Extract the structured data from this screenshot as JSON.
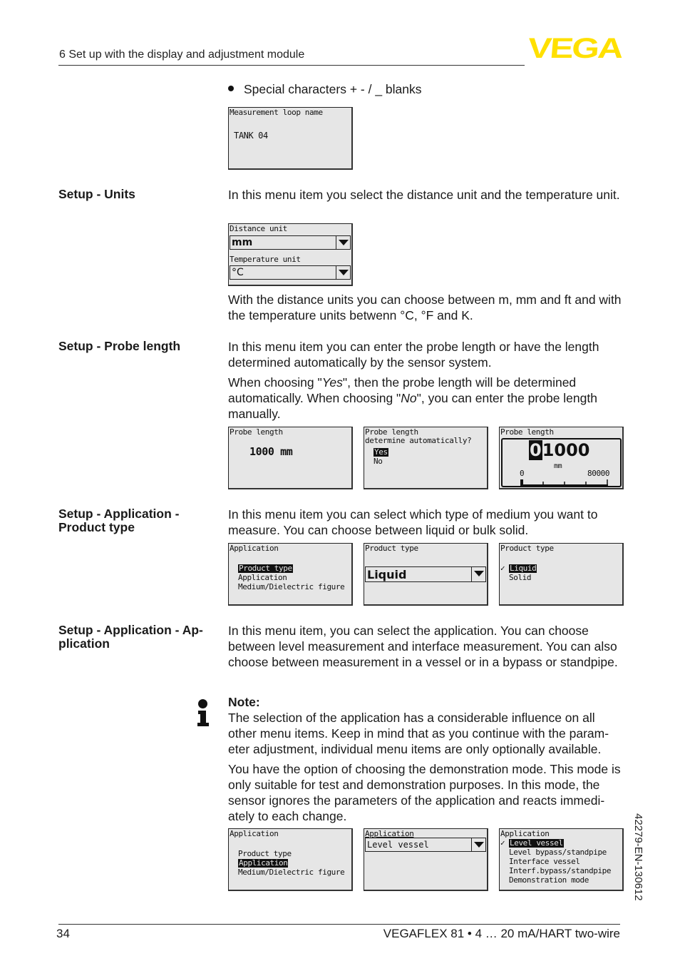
{
  "header": {
    "title": "6 Set up with the display and adjustment module",
    "logo_text": "VEGA",
    "logo_color": "#ffe000"
  },
  "intro": {
    "bullet": "Special characters + - / _ blanks"
  },
  "lcd_loop_name": {
    "title": "Measurement loop name",
    "value": "TANK 04"
  },
  "units": {
    "label": "Setup - Units",
    "text1": "In this menu item you select the distance unit and the temperature unit.",
    "lcd": {
      "distance_label": "Distance unit",
      "distance_value": "mm",
      "temperature_label": "Temperature unit",
      "temperature_value": "°C"
    },
    "text2": "With the distance units you can choose between m, mm and ft and with the temperature units betwenn °C, °F and K."
  },
  "probe_length": {
    "label": "Setup - Probe length",
    "text1": "In this menu item you can enter the probe length or have the length determined automatically by the sensor system.",
    "text2_pre": "When choosing \"",
    "text2_yes": "Yes",
    "text2_mid": "\", then the probe length will be determined automatically. When choosing \"",
    "text2_no": "No",
    "text2_post": "\", you can enter the probe length manually.",
    "lcd1": {
      "title": "Probe length",
      "value": "1000 mm"
    },
    "lcd2": {
      "title": "Probe length",
      "subtitle": "determine automatically?",
      "options": [
        "Yes",
        "No"
      ],
      "selected": "Yes"
    },
    "lcd3": {
      "title": "Probe length",
      "cursor_digit": "0",
      "value_rest": "1000",
      "unit": "mm",
      "scale_min": "0",
      "scale_max": "80000"
    }
  },
  "product_type": {
    "label_line1": "Setup - Application -",
    "label_line2": "Product type",
    "text": "In this menu item you can select which type of medium you want to measure. You can choose between liquid or bulk solid.",
    "lcd1": {
      "title": "Application",
      "items": [
        "Product type",
        "Application",
        "Medium/Dielectric figure"
      ],
      "selected": "Product type"
    },
    "lcd2": {
      "title": "Product type",
      "value": "Liquid"
    },
    "lcd3": {
      "title": "Product type",
      "options": [
        "Liquid",
        "Solid"
      ],
      "selected": "Liquid",
      "check": "✓"
    }
  },
  "application": {
    "label_line1": "Setup - Application - Ap-",
    "label_line2": "plication",
    "text": "In this menu item, you can select the application. You can choose between level measurement and interface measurement. You can also choose between measurement in a vessel or in a bypass or standpipe.",
    "note_title": "Note:",
    "note_text": "The selection of the application has a considerable influence on all other menu items. Keep in mind that as you continue with the param-eter adjustment, individual menu items are only optionally available.",
    "demo_text": "You have the option of choosing the demonstration mode. This mode is only suitable for test and demonstration purposes. In this mode, the sensor ignores the parameters of the application and reacts immedi-ately to each change.",
    "lcd1": {
      "title": "Application",
      "items": [
        "Product type",
        "Application",
        "Medium/Dielectric figure"
      ],
      "selected": "Application"
    },
    "lcd2": {
      "title": "Application",
      "value": "Level vessel"
    },
    "lcd3": {
      "title": "Application",
      "options": [
        "Level vessel",
        "Level bypass/standpipe",
        "Interface vessel",
        "Interf.bypass/standpipe",
        "Demonstration mode"
      ],
      "selected": "Level vessel",
      "check": "✓"
    }
  },
  "side_code": "42279-EN-130612",
  "footer": {
    "page": "34",
    "product": "VEGAFLEX 81 • 4 … 20 mA/HART two-wire"
  }
}
